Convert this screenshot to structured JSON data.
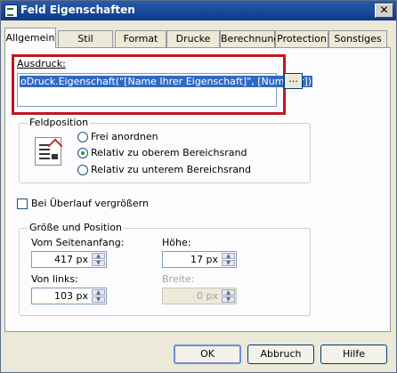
{
  "window": {
    "title": "Feld Eigenschaften",
    "close_label": "✕"
  },
  "tabs": [
    {
      "label": "Allgemein"
    },
    {
      "label": "Stil"
    },
    {
      "label": "Format"
    },
    {
      "label": "Drucke Wer"
    },
    {
      "label": "Berechnung"
    },
    {
      "label": "Protection"
    },
    {
      "label": "Sonstiges"
    }
  ],
  "expression": {
    "label": "Ausdruck:",
    "value": "oDruck.Eigenschaft(\"[Name Ihrer Eigenschaft]\", [Nummer])",
    "browse_label": "..."
  },
  "feldposition": {
    "title": "Feldposition",
    "options": [
      {
        "label": "Frei anordnen",
        "selected": false
      },
      {
        "label": "Relativ zu oberem Bereichsrand",
        "selected": true
      },
      {
        "label": "Relativ zu unterem Bereichsrand",
        "selected": false
      }
    ]
  },
  "overflow": {
    "label": "Bei Überlauf vergrößern",
    "checked": false
  },
  "size_position": {
    "title": "Größe und Position",
    "top": {
      "label": "Vom Seitenanfang:",
      "value": "417 px"
    },
    "height": {
      "label": "Höhe:",
      "value": "17 px"
    },
    "left": {
      "label": "Von links:",
      "value": "103 px"
    },
    "width": {
      "label": "Breite:",
      "value": "0 px",
      "disabled": true
    }
  },
  "buttons": {
    "ok": "OK",
    "cancel": "Abbruch",
    "help": "Hilfe"
  },
  "colors": {
    "title_bar": "#0a3a8a",
    "highlight_box": "#c4151c",
    "selection": "#316ac5"
  }
}
